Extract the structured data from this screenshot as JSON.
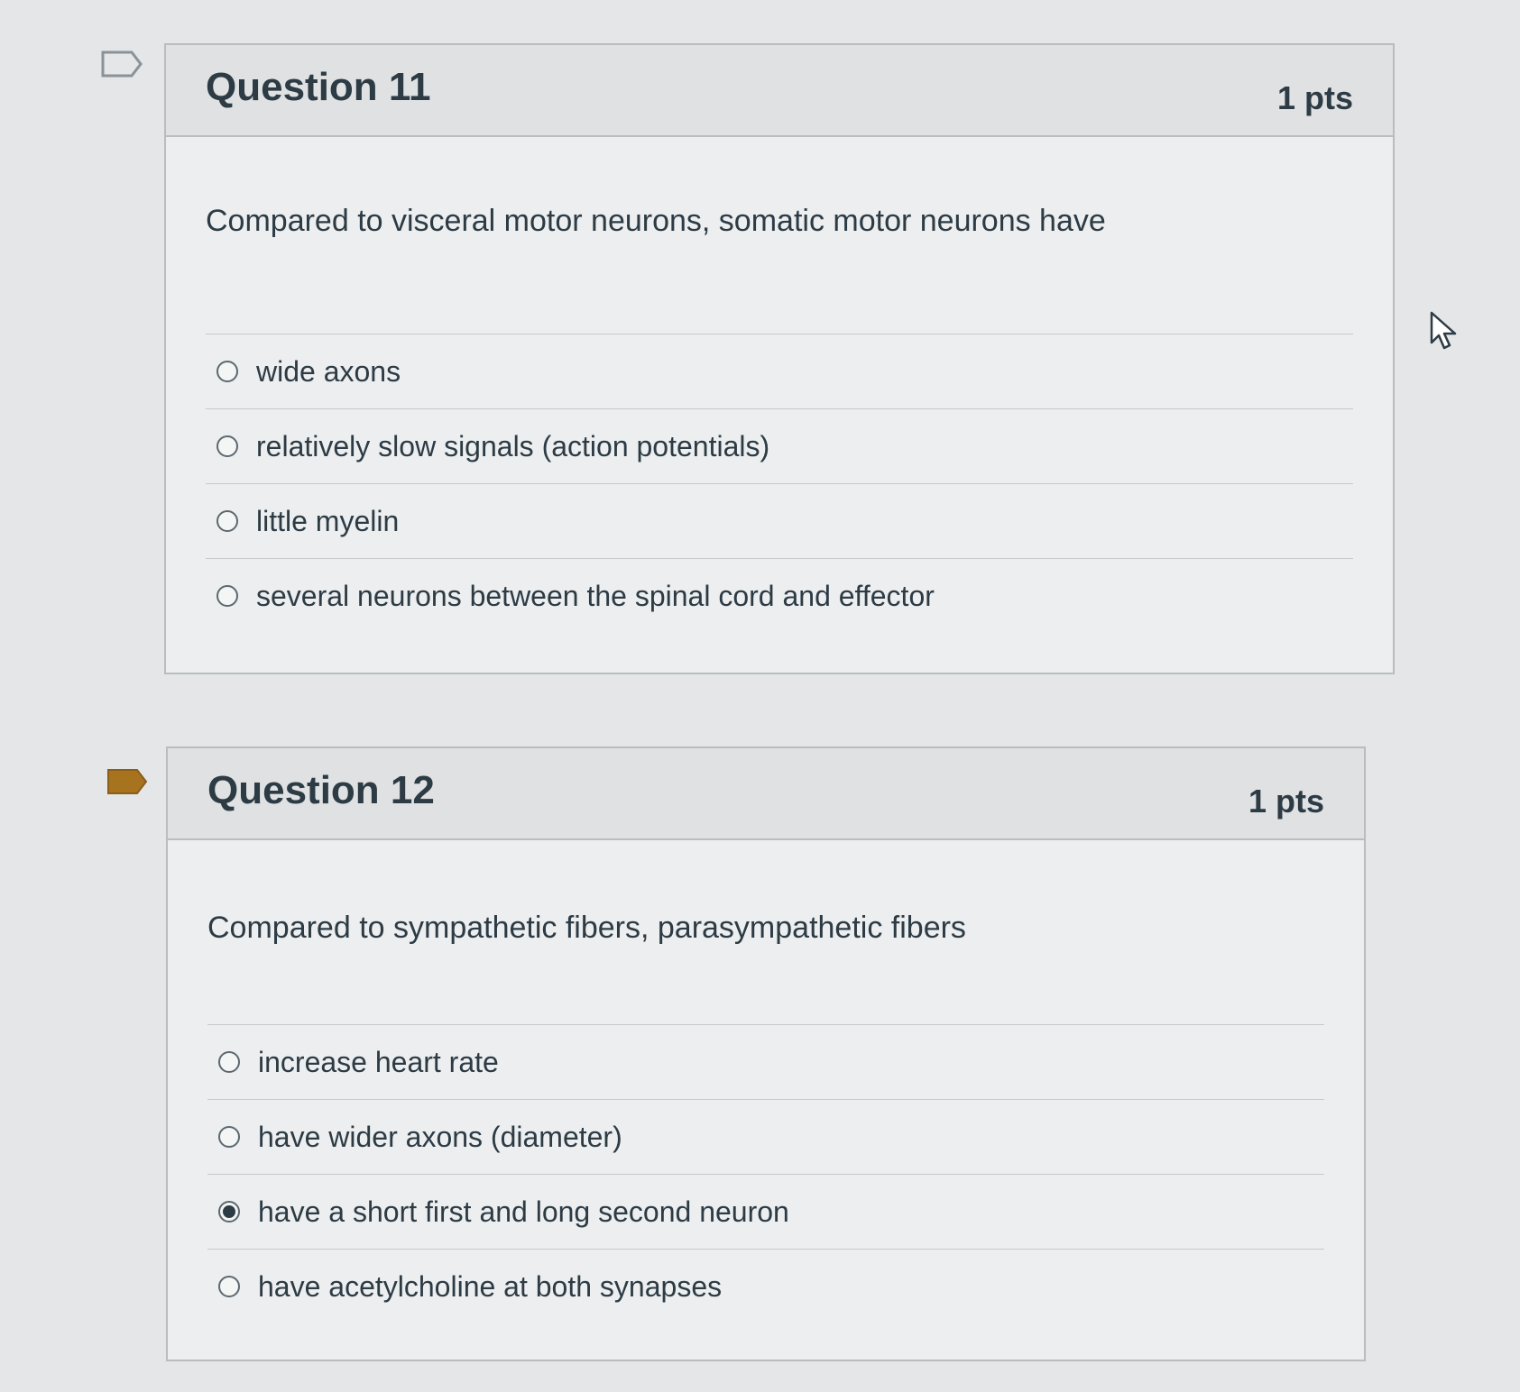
{
  "questions": [
    {
      "title": "Question 11",
      "points": "1 pts",
      "flagged": false,
      "prompt": "Compared to visceral motor neurons, somatic motor neurons have",
      "answers": [
        {
          "label": "wide axons",
          "selected": false
        },
        {
          "label": "relatively slow signals (action potentials)",
          "selected": false
        },
        {
          "label": "little myelin",
          "selected": false
        },
        {
          "label": "several neurons between the spinal cord and effector",
          "selected": false
        }
      ]
    },
    {
      "title": "Question 12",
      "points": "1 pts",
      "flagged": true,
      "prompt": "Compared to sympathetic fibers, parasympathetic fibers",
      "answers": [
        {
          "label": "increase heart rate",
          "selected": false
        },
        {
          "label": "have wider axons (diameter)",
          "selected": false
        },
        {
          "label": "have a short first and long second neuron",
          "selected": true
        },
        {
          "label": "have acetylcholine at both synapses",
          "selected": false
        }
      ]
    }
  ],
  "colors": {
    "flag_active": "#a8731f",
    "flag_inactive_stroke": "#8a9299"
  },
  "icons": {
    "flag": "bookmark-flag-icon",
    "cursor": "mouse-pointer-icon"
  }
}
